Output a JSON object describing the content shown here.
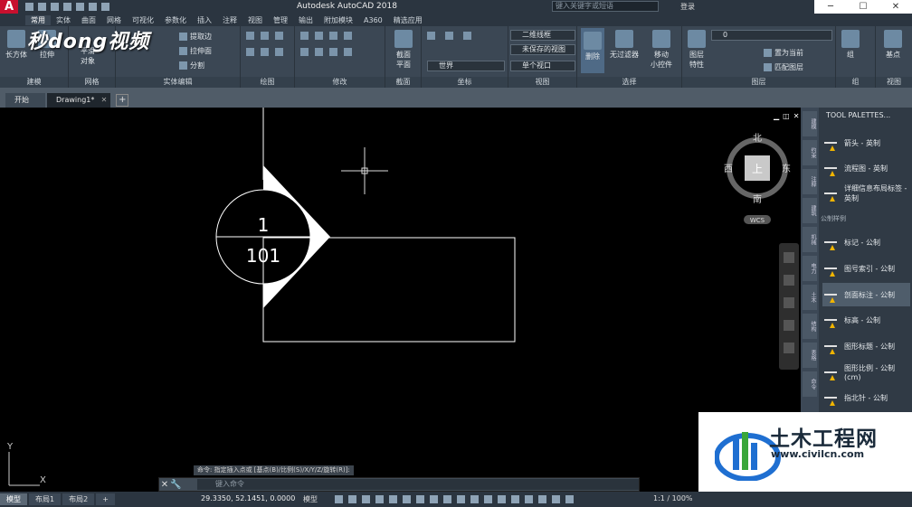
{
  "titlebar": {
    "app_letter": "A",
    "title": "Autodesk AutoCAD 2018",
    "search_placeholder": "键入关键字或短语",
    "login": "登录",
    "win_min": "─",
    "win_max": "☐",
    "win_close": "✕"
  },
  "ribbon_tabs": [
    "常用",
    "实体",
    "曲面",
    "网格",
    "可视化",
    "参数化",
    "插入",
    "注释",
    "视图",
    "管理",
    "输出",
    "附加模块",
    "A360",
    "精选应用"
  ],
  "ribbon": {
    "modeling": {
      "label": "建模",
      "box": "长方体",
      "extrude": "拉伸"
    },
    "mesh": {
      "label": "网格",
      "smooth": "平滑",
      "object": "对象"
    },
    "solid_edit": {
      "label": "实体编辑",
      "extract": "提取边",
      "press": "拉伸面",
      "split": "分割"
    },
    "draw": {
      "label": "绘图"
    },
    "modify": {
      "label": "修改"
    },
    "section": {
      "label": "截面",
      "plane1": "截面",
      "plane2": "平面"
    },
    "coords": {
      "label": "坐标",
      "world": "世界"
    },
    "view": {
      "label": "视图",
      "visual_style": "二维线框",
      "saved_view": "未保存的视图",
      "single_viewport": "单个视口"
    },
    "selection": {
      "label": "选择",
      "delete": "删除",
      "filter": "无过滤器",
      "move": "移动",
      "gizmo": "小控件"
    },
    "layers": {
      "label": "图层",
      "layer_props": "图层",
      "props2": "特性",
      "layer_name": "0",
      "set_current": "置为当前",
      "match": "匹配图层"
    },
    "groups": {
      "label": "组",
      "group": "组"
    },
    "viewpanel": {
      "label": "视图",
      "base": "基点"
    }
  },
  "watermark": "秒dong视频",
  "doc_tabs": [
    {
      "label": "开始"
    },
    {
      "label": "Drawing1*"
    }
  ],
  "doc_tab_close": "✕",
  "doc_tab_add": "+",
  "drawing": {
    "top_number": "1",
    "bottom_number": "101"
  },
  "viewcube": {
    "north": "北",
    "south": "南",
    "west": "西",
    "east": "东",
    "top": "上",
    "wcs": "WCS"
  },
  "ucs": {
    "x": "X",
    "y": "Y"
  },
  "palette": {
    "title": "TOOL PALETTES...",
    "section": "公制样例",
    "items": [
      "箭头 - 英制",
      "流程图 - 英制",
      "详细信息布局标签 - 英制",
      "标记 - 公制",
      "图号索引 - 公制",
      "剖面标注 - 公制",
      "标高 - 公制",
      "图形标题 - 公制",
      "图形比例 - 公制 (cm)",
      "指北针 - 公制"
    ],
    "side_tabs": [
      "建模",
      "约束",
      "注释",
      "建筑",
      "机械",
      "电力",
      "土木",
      "结构",
      "表格",
      "命令"
    ]
  },
  "command": {
    "history": "命令: 指定插入点或 [基点(B)/比例(S)/X/Y/Z/旋转(R)]:",
    "placeholder": "键入命令"
  },
  "layout_tabs": [
    "模型",
    "布局1",
    "布局2"
  ],
  "status": {
    "coords": "29.3350, 52.1451, 0.0000",
    "model": "模型",
    "zoom": "1:1 / 100%"
  },
  "logo": {
    "cn": "土木工程网",
    "url": "www.civilcn.com"
  },
  "colors": {
    "accent_red": "#c8102e",
    "ribbon_bg": "#3b4754",
    "logo_blue": "#1f6fd1",
    "logo_green": "#3aa63a"
  }
}
